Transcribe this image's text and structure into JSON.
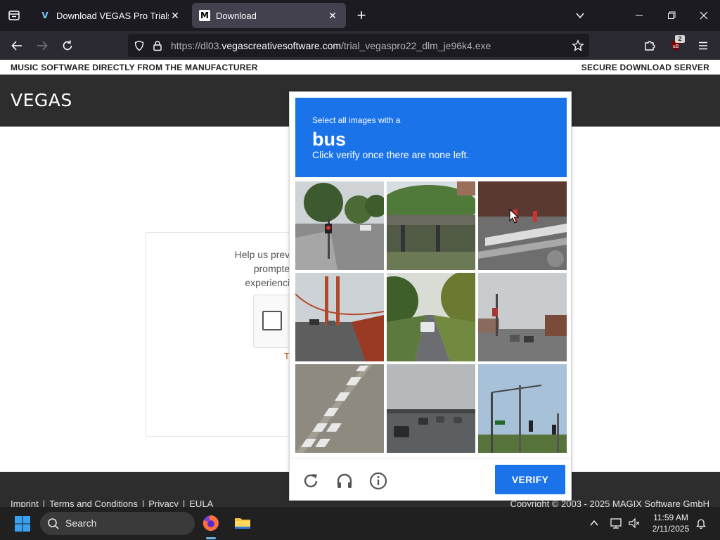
{
  "browser": {
    "tabs": [
      {
        "title": "Download VEGAS Pro Trials for",
        "favicon": "V"
      },
      {
        "title": "Download",
        "favicon": "M"
      }
    ],
    "url_prefix": "https://dl03.",
    "url_domain": "vegascreativesoftware.com",
    "url_path": "/trial_vegaspro22_dlm_je96k4.exe",
    "extension_badge": "2"
  },
  "page": {
    "strip_left": "MUSIC SOFTWARE DIRECTLY FROM THE MANUFACTURER",
    "strip_right": "SECURE DOWNLOAD SERVER",
    "logo": "VEGAS",
    "card_lines": [
      "Help us preve",
      "prompted",
      "experiencin"
    ],
    "card_orange": "T",
    "footer_links": [
      "Imprint",
      "Terms and Conditions",
      "Privacy",
      "EULA"
    ],
    "footer_sep": "|",
    "copyright": "Copyright © 2003 - 2025 MAGIX Software GmbH"
  },
  "captcha": {
    "prompt": "Select all images with a",
    "target": "bus",
    "instruction": "Click verify once there are none left.",
    "verify_label": "VERIFY",
    "tiles": [
      {
        "name": "street-corner-trees"
      },
      {
        "name": "overpass-trees"
      },
      {
        "name": "crosswalk-brick"
      },
      {
        "name": "golden-gate-bridge"
      },
      {
        "name": "tree-lined-road"
      },
      {
        "name": "town-street"
      },
      {
        "name": "road-markings"
      },
      {
        "name": "rainy-highway"
      },
      {
        "name": "traffic-lights-sky"
      }
    ]
  },
  "taskbar": {
    "search_placeholder": "Search",
    "time": "11:59 AM",
    "date": "2/11/2025"
  },
  "colors": {
    "captcha_blue": "#1a73e8",
    "tabbar_bg": "#1c1b22",
    "navbar_bg": "#2b2a33",
    "page_header_bg": "#2d2d2d",
    "taskbar_bg": "#202020"
  }
}
